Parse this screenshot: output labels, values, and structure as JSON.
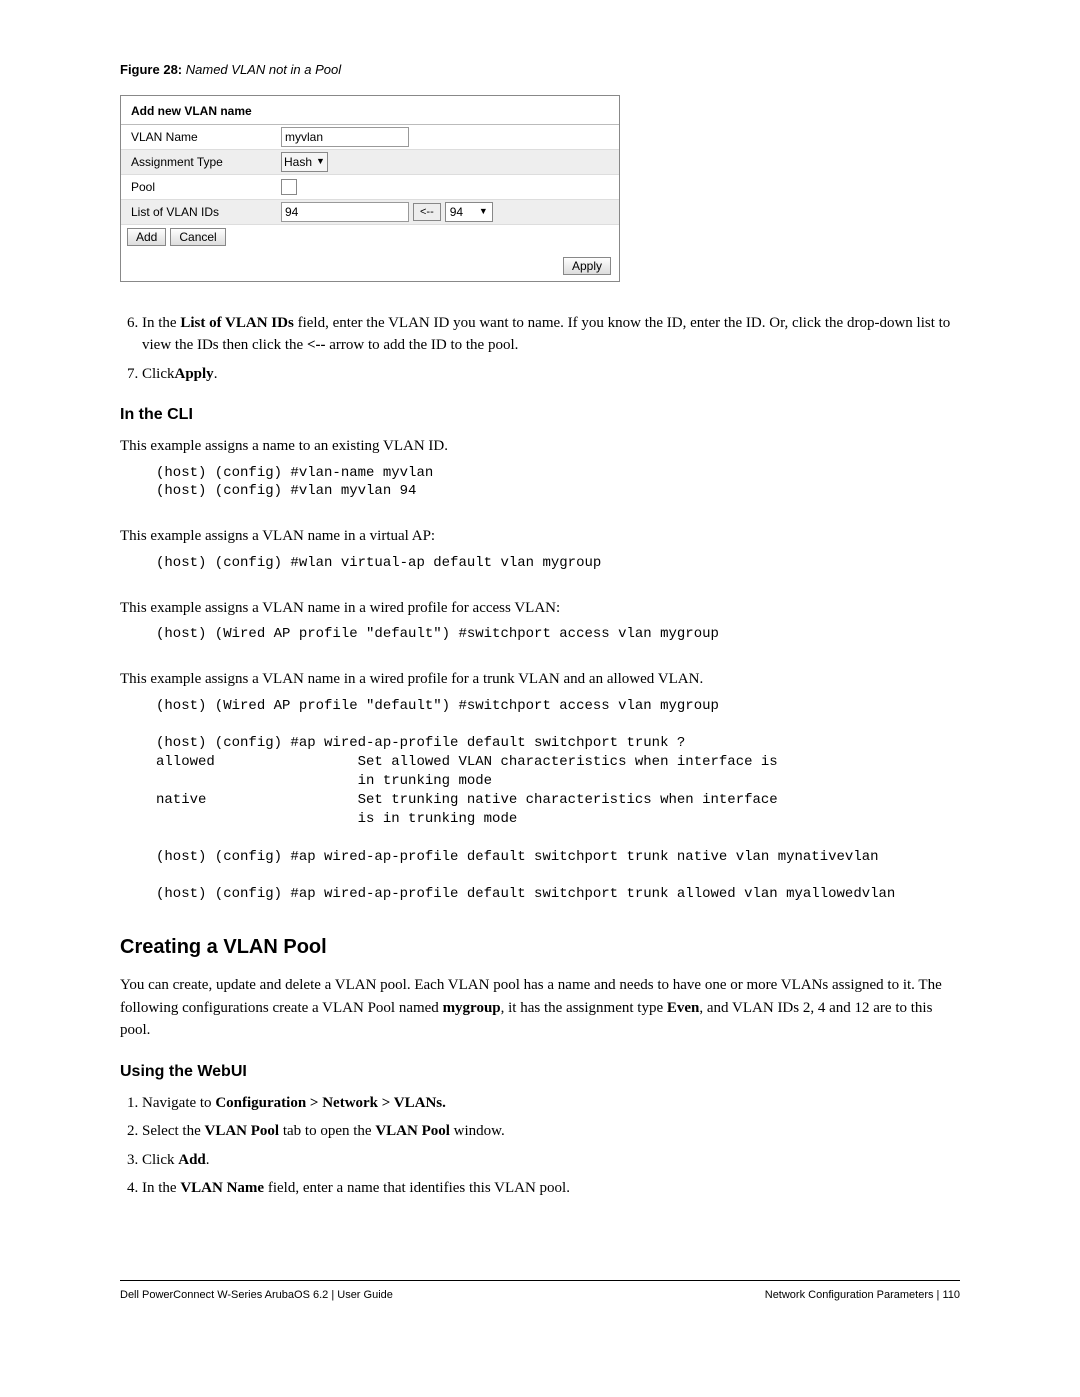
{
  "figure": {
    "label": "Figure 28:",
    "title": "Named VLAN not in a Pool"
  },
  "dialog": {
    "title": "Add new VLAN name",
    "rows": {
      "name_label": "VLAN Name",
      "name_value": "myvlan",
      "assign_label": "Assignment Type",
      "assign_value": "Hash",
      "pool_label": "Pool",
      "ids_label": "List of VLAN IDs",
      "ids_value": "94",
      "arrow_label": "<--",
      "ids_dropdown": "94"
    },
    "buttons": {
      "add": "Add",
      "cancel": "Cancel",
      "apply": "Apply"
    }
  },
  "steps1": {
    "item6a": "In the ",
    "item6b": "List of VLAN IDs",
    "item6c": " field, enter the VLAN ID you want to name. If you know the ID, enter the ID. Or, click the drop-down list to view the IDs then click the ",
    "item6d": "<--",
    "item6e": " arrow to add the ID to the pool.",
    "item7a": "Click",
    "item7b": "Apply",
    "item7c": "."
  },
  "cli_heading": "In the CLI",
  "cli_intro1": "This example assigns a name to an existing VLAN ID.",
  "cli_code1": "(host) (config) #vlan-name myvlan\n(host) (config) #vlan myvlan 94",
  "cli_intro2": "This example assigns a VLAN name in a virtual AP:",
  "cli_code2": "(host) (config) #wlan virtual-ap default vlan mygroup",
  "cli_intro3": "This example assigns a VLAN name in a wired profile for access VLAN:",
  "cli_code3": "(host) (Wired AP profile \"default\") #switchport access vlan mygroup",
  "cli_intro4": "This example assigns a VLAN name in a wired profile for a trunk VLAN and an allowed VLAN.",
  "cli_code4": "(host) (Wired AP profile \"default\") #switchport access vlan mygroup\n\n(host) (config) #ap wired-ap-profile default switchport trunk ?\nallowed                 Set allowed VLAN characteristics when interface is\n                        in trunking mode\nnative                  Set trunking native characteristics when interface\n                        is in trunking mode\n\n(host) (config) #ap wired-ap-profile default switchport trunk native vlan mynativevlan\n\n(host) (config) #ap wired-ap-profile default switchport trunk allowed vlan myallowedvlan",
  "pool_heading": "Creating a VLAN Pool",
  "pool_body_parts": {
    "a": "You can create, update and delete a VLAN pool. Each VLAN pool has a name and needs to have one or more VLANs assigned to it. The following configurations create a VLAN Pool named ",
    "b": "mygroup",
    "c": ", it has the assignment type ",
    "d": "Even",
    "e": ", and VLAN IDs 2, 4 and 12 are to this pool."
  },
  "webui_heading": "Using the WebUI",
  "webui_steps": {
    "s1a": "Navigate to ",
    "s1b": "Configuration > Network > VLANs.",
    "s2a": "Select the ",
    "s2b": "VLAN Pool",
    "s2c": " tab to open the ",
    "s2d": "VLAN Pool",
    "s2e": " window.",
    "s3a": "Click ",
    "s3b": "Add",
    "s3c": ".",
    "s4a": "In the ",
    "s4b": "VLAN Name",
    "s4c": " field, enter a name that identifies this VLAN pool."
  },
  "footer": {
    "left": "Dell PowerConnect W-Series ArubaOS 6.2 | User Guide",
    "right": "Network Configuration Parameters | 110"
  }
}
